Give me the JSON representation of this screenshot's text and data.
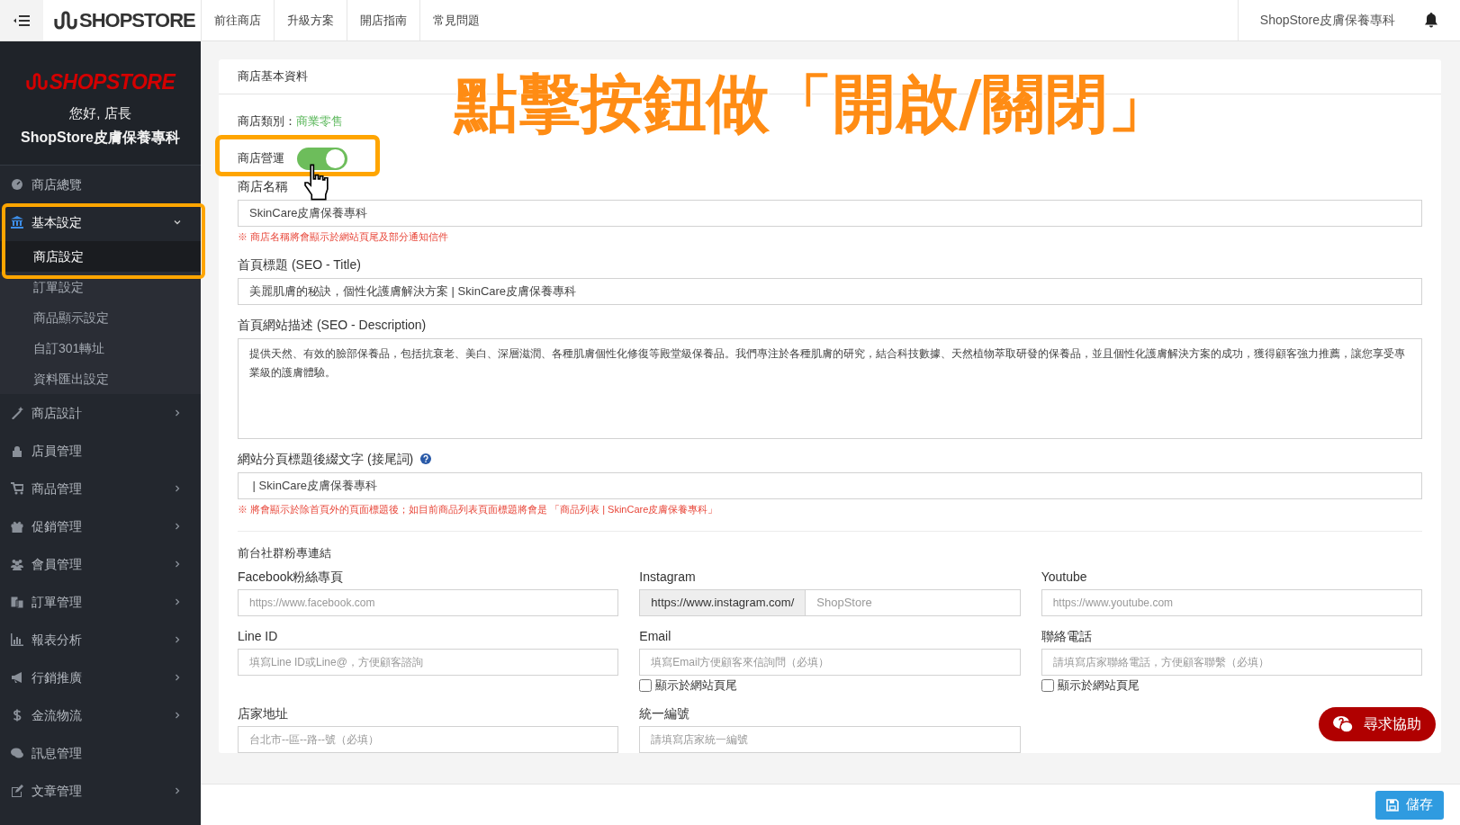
{
  "topbar": {
    "logo": "SHOPSTORE",
    "nav_links": [
      "前往商店",
      "升級方案",
      "開店指南",
      "常見問題"
    ],
    "account": "ShopStore皮膚保養專科"
  },
  "sidebar": {
    "logo": "SHOPSTORE",
    "greeting": "您好, 店長",
    "store": "ShopStore皮膚保養專科",
    "items": [
      {
        "label": "商店總覽",
        "expandable": false,
        "expanded": false
      },
      {
        "label": "基本設定",
        "expandable": true,
        "expanded": true,
        "children": [
          {
            "label": "商店設定",
            "selected": true
          },
          {
            "label": "訂單設定",
            "selected": false
          },
          {
            "label": "商品顯示設定",
            "selected": false
          },
          {
            "label": "自訂301轉址",
            "selected": false
          },
          {
            "label": "資料匯出設定",
            "selected": false
          }
        ]
      },
      {
        "label": "商店設計",
        "expandable": true,
        "expanded": false
      },
      {
        "label": "店員管理",
        "expandable": false,
        "expanded": false
      },
      {
        "label": "商品管理",
        "expandable": true,
        "expanded": false
      },
      {
        "label": "促銷管理",
        "expandable": true,
        "expanded": false
      },
      {
        "label": "會員管理",
        "expandable": true,
        "expanded": false
      },
      {
        "label": "訂單管理",
        "expandable": true,
        "expanded": false
      },
      {
        "label": "報表分析",
        "expandable": true,
        "expanded": false
      },
      {
        "label": "行銷推廣",
        "expandable": true,
        "expanded": false
      },
      {
        "label": "金流物流",
        "expandable": true,
        "expanded": false
      },
      {
        "label": "訊息管理",
        "expandable": false,
        "expanded": false
      },
      {
        "label": "文章管理",
        "expandable": true,
        "expanded": false
      }
    ]
  },
  "card": {
    "title": "商店基本資料",
    "category_label": "商店類別：",
    "category_value": "商業零售",
    "toggle": {
      "label": "商店營運",
      "on": true
    },
    "fields": [
      {
        "kind": "input",
        "label": "商店名稱",
        "value": "SkinCare皮膚保養專科",
        "note": "※ 商店名稱將會顯示於網站頁尾及部分通知信件",
        "help": false
      },
      {
        "kind": "input",
        "label": "首頁標題 (SEO - Title)",
        "value": "美麗肌膚的秘訣，個性化護膚解決方案 | SkinCare皮膚保養專科",
        "help": false
      },
      {
        "kind": "textarea",
        "label": "首頁網站描述 (SEO - Description)",
        "value": "提供天然、有效的臉部保養品，包括抗衰老、美白、深層滋潤、各種肌膚個性化修復等殿堂級保養品。我們專注於各種肌膚的研究，結合科技數據、天然植物萃取研發的保養品，並且個性化護膚解決方案的成功，獲得顧客強力推薦，讓您享受專業級的護膚體驗。",
        "help": false
      },
      {
        "kind": "input",
        "label": "網站分頁標題後綴文字 (接尾詞)",
        "value": " | SkinCare皮膚保養專科",
        "note": "※ 將會顯示於除首頁外的頁面標題後；如目前商品列表頁面標題將會是 「商品列表 | SkinCare皮膚保養專科」",
        "help": true
      }
    ],
    "social": {
      "title": "前台社群粉專連結",
      "fields": [
        {
          "label": "Facebook粉絲專頁",
          "placeholder": "https://www.facebook.com"
        },
        {
          "label": "Instagram",
          "prefix": "https://www.instagram.com/",
          "placeholder": "ShopStore"
        },
        {
          "label": "Youtube",
          "placeholder": "https://www.youtube.com"
        },
        {
          "label": "Line ID",
          "placeholder": "填寫Line ID或Line@，方便顧客諮詢"
        },
        {
          "label": "Email",
          "placeholder": "填寫Email方便顧客來信詢問（必填）",
          "checkbox": {
            "label": "顯示於網站頁尾",
            "checked": false
          }
        },
        {
          "label": "聯絡電話",
          "placeholder": "請填寫店家聯絡電話，方便顧客聯繫（必填）",
          "checkbox": {
            "label": "顯示於網站頁尾",
            "checked": false
          }
        },
        {
          "label": "店家地址",
          "placeholder": "台北市--區--路--號（必填）"
        },
        {
          "label": "統一編號",
          "placeholder": "請填寫店家統一編號"
        }
      ]
    }
  },
  "help_button": "尋求協助",
  "save_button": "儲存",
  "annotation": {
    "text": "點擊按鈕做「開啟/關閉」"
  }
}
